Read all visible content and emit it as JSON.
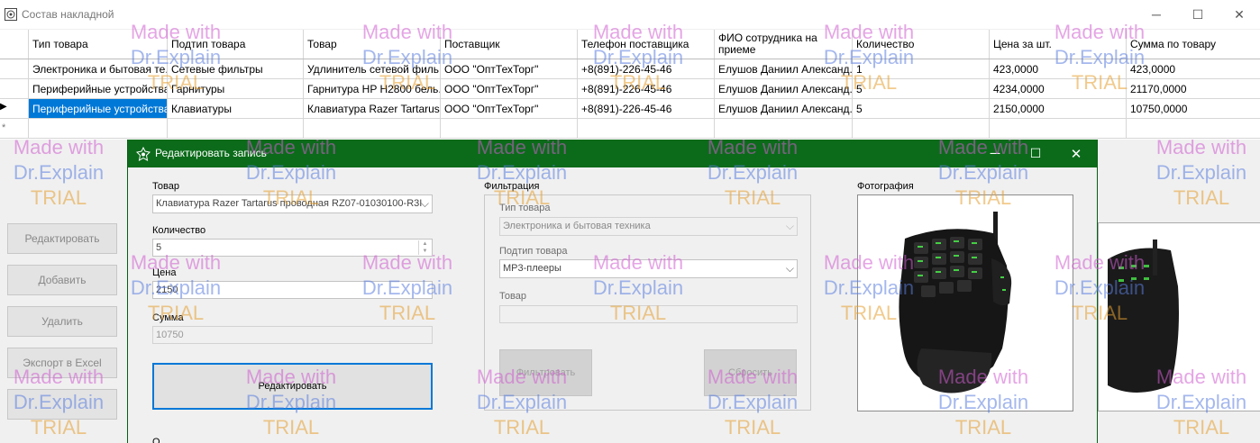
{
  "background_window": {
    "title": "Состав накладной",
    "grid": {
      "columns": [
        "Тип товара",
        "Подтип товара",
        "Товар",
        "Поставщик",
        "Телефон поставщика",
        "ФИО сотрудника на приеме",
        "Количество",
        "Цена за шт.",
        "Сумма по товару"
      ],
      "rows": [
        [
          "Электроника и бытовая те...",
          "Сетевые фильтры",
          "Удлинитель сетевой филь...",
          "ООО \"ОптТехТорг\"",
          "+8(891)-226-45-46",
          "Елушов Даниил Александ...",
          "1",
          "423,0000",
          "423,0000"
        ],
        [
          "Периферийные устройства",
          "Гарнитуры",
          "Гарнитура HP H2800 бель...",
          "ООО \"ОптТехТорг\"",
          "+8(891)-226-45-46",
          "Елушов Даниил Александ...",
          "5",
          "4234,0000",
          "21170,0000"
        ],
        [
          "Периферийные устройства",
          "Клавиатуры",
          "Клавиатура Razer Tartarus ...",
          "ООО \"ОптТехТорг\"",
          "+8(891)-226-45-46",
          "Елушов Даниил Александ...",
          "5",
          "2150,0000",
          "10750,0000"
        ]
      ],
      "new_row_marker": "*",
      "current_row_marker": "▶"
    },
    "buttons": {
      "edit": "Редактировать",
      "add": "Добавить",
      "delete": "Удалить",
      "export": "Экспорт в Excel"
    }
  },
  "dialog": {
    "title": "Редактировать запись",
    "product_label": "Товар",
    "product_value": "Клавиатура Razer Tartarus проводная RZ07-01030100-R3I",
    "quantity_label": "Количество",
    "quantity_value": "5",
    "price_label": "Цена",
    "price_value": "2150",
    "sum_label": "Сумма",
    "sum_value": "10750",
    "edit_button": "Редактировать",
    "bottom_label_partial": "О",
    "filter": {
      "title": "Фильтрация",
      "type_label": "Тип товара",
      "type_value": "Электроника и бытовая техника",
      "subtype_label": "Подтип товара",
      "subtype_value": "MP3-плееры",
      "product_label": "Товар",
      "product_value": "",
      "apply_button": "Фильтровать",
      "reset_button": "Сбросить"
    },
    "photo_label": "Фотография"
  },
  "watermark": {
    "line1": "Made with",
    "line2": "Dr.Explain",
    "line3": "TRIAL"
  },
  "colors": {
    "dialog_titlebar": "#0b6b1a",
    "selection": "#0078d7",
    "primary_border": "#0078d7"
  }
}
